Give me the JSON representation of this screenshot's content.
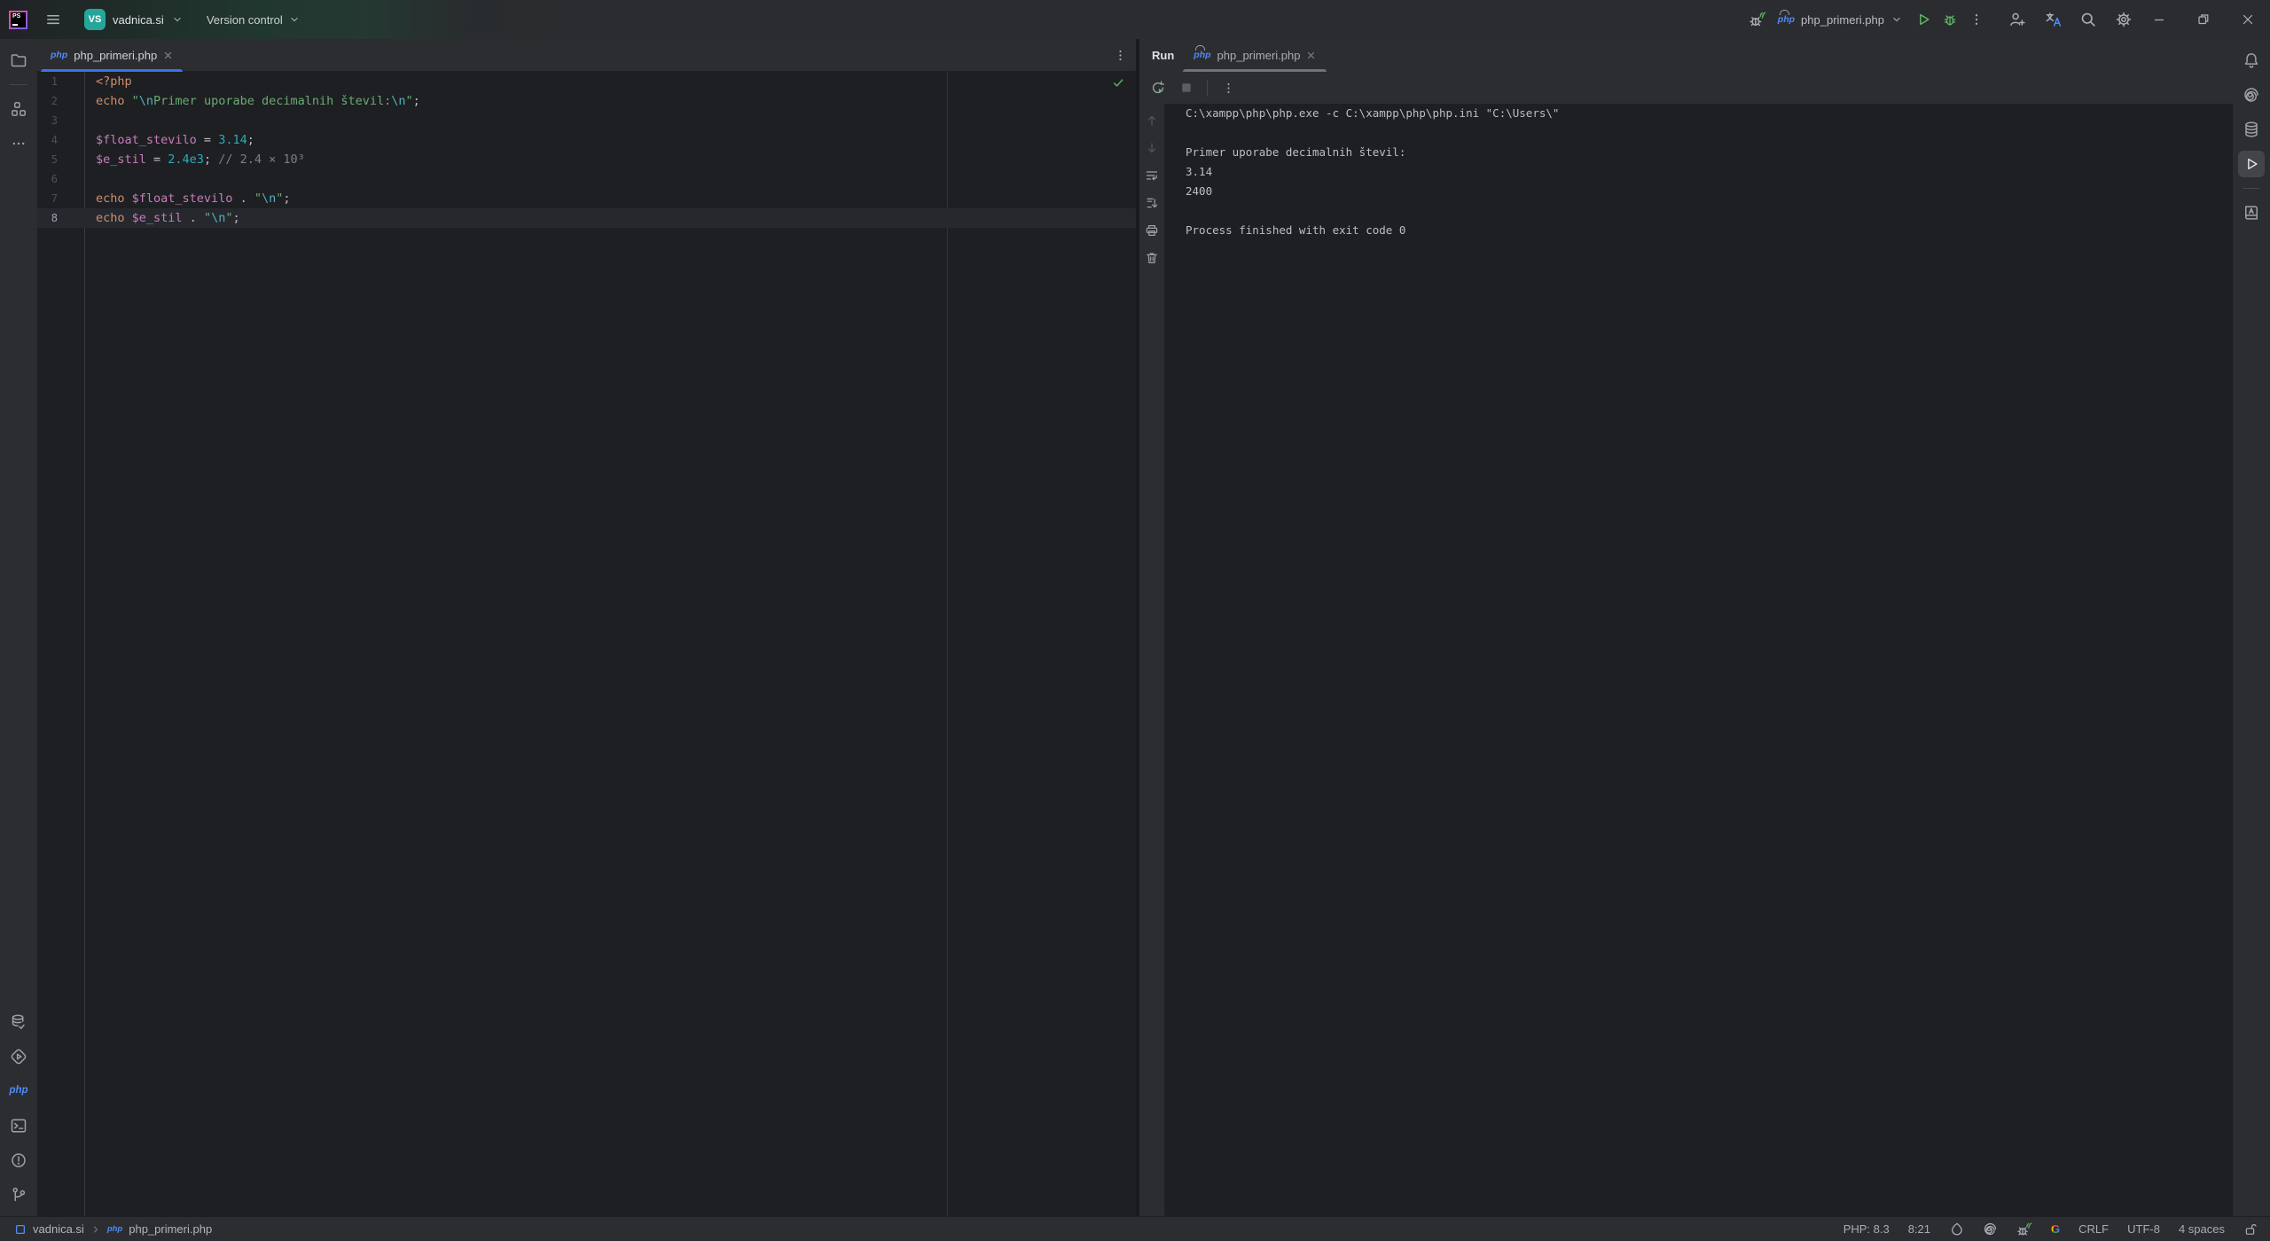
{
  "colors": {
    "accent_blue": "#3574f0",
    "run_green": "#5fb865",
    "panel_bg": "#2b2d30",
    "editor_bg": "#1e1f22",
    "keyword_orange": "#cf8e6d",
    "string_green": "#6aab73",
    "escape_teal": "#4fb3bf",
    "variable_purple": "#c77dbb",
    "number_cyan": "#2aacb8",
    "comment_gray": "#7a7e85",
    "project_avatar_teal": "#26a69a"
  },
  "icons": {
    "php_file_label": "php",
    "google_label": "G"
  },
  "titlebar": {
    "app_badge": "PS",
    "project_avatar": "VS",
    "project_name": "vadnica.si",
    "version_control": "Version control",
    "run_config_name": "php_primeri.php"
  },
  "editor": {
    "tab": {
      "label": "php_primeri.php"
    },
    "current_line": 8,
    "lines": [
      [
        {
          "t": "<?php",
          "c": "kw"
        }
      ],
      [
        {
          "t": "echo ",
          "c": "kw"
        },
        {
          "t": "\"",
          "c": "str"
        },
        {
          "t": "\\n",
          "c": "esc"
        },
        {
          "t": "Primer uporabe decimalnih števil:",
          "c": "str"
        },
        {
          "t": "\\n",
          "c": "esc"
        },
        {
          "t": "\"",
          "c": "str"
        },
        {
          "t": ";",
          "c": "pl"
        }
      ],
      [],
      [
        {
          "t": "$float_stevilo",
          "c": "var"
        },
        {
          "t": " = ",
          "c": "pl"
        },
        {
          "t": "3.14",
          "c": "num"
        },
        {
          "t": ";",
          "c": "pl"
        }
      ],
      [
        {
          "t": "$e_stil",
          "c": "var"
        },
        {
          "t": " = ",
          "c": "pl"
        },
        {
          "t": "2.4e3",
          "c": "num"
        },
        {
          "t": "; ",
          "c": "pl"
        },
        {
          "t": "// 2.4 × 10³",
          "c": "com"
        }
      ],
      [],
      [
        {
          "t": "echo ",
          "c": "kw"
        },
        {
          "t": "$float_stevilo",
          "c": "var"
        },
        {
          "t": " . ",
          "c": "pl"
        },
        {
          "t": "\"",
          "c": "str"
        },
        {
          "t": "\\n",
          "c": "esc"
        },
        {
          "t": "\"",
          "c": "str"
        },
        {
          "t": ";",
          "c": "pl"
        }
      ],
      [
        {
          "t": "echo ",
          "c": "kw"
        },
        {
          "t": "$e_stil",
          "c": "var"
        },
        {
          "t": " . ",
          "c": "pl"
        },
        {
          "t": "\"",
          "c": "str"
        },
        {
          "t": "\\n",
          "c": "esc"
        },
        {
          "t": "\"",
          "c": "str"
        },
        {
          "t": ";",
          "c": "pl"
        }
      ]
    ]
  },
  "run_panel": {
    "title": "Run",
    "tab_label": "php_primeri.php",
    "console_lines": [
      "C:\\xampp\\php\\php.exe -c C:\\xampp\\php\\php.ini \"C:\\Users\\\"",
      "",
      "Primer uporabe decimalnih števil:",
      "3.14",
      "2400",
      "",
      "Process finished with exit code 0"
    ]
  },
  "statusbar": {
    "breadcrumb_project": "vadnica.si",
    "breadcrumb_file": "php_primeri.php",
    "php_version": "PHP: 8.3",
    "caret_position": "8:21",
    "line_separator": "CRLF",
    "encoding": "UTF-8",
    "indent": "4 spaces"
  }
}
